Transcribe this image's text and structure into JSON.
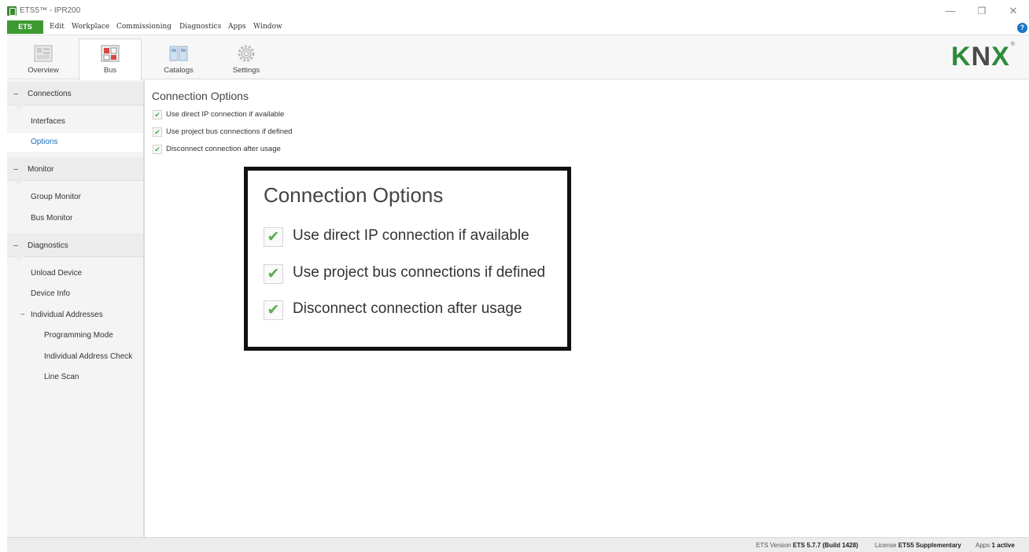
{
  "window": {
    "title": "ETS5™ - IPR200",
    "minimize_glyph": "—",
    "maximize_glyph": "❐",
    "close_glyph": "✕"
  },
  "menubar": {
    "ets_label": "ETS",
    "items": [
      "Edit",
      "Workplace",
      "Commissioning",
      "Diagnostics",
      "Apps",
      "Window"
    ],
    "help_glyph": "?"
  },
  "ribbon": {
    "tabs": [
      {
        "label": "Overview",
        "icon": "overview-icon"
      },
      {
        "label": "Bus",
        "icon": "bus-icon",
        "active": true
      },
      {
        "label": "Catalogs",
        "icon": "catalogs-icon"
      },
      {
        "label": "Settings",
        "icon": "settings-gear-icon"
      }
    ],
    "brand": {
      "k": "K",
      "n": "N",
      "x": "X",
      "reg": "®"
    }
  },
  "sidebar": {
    "sections": [
      {
        "label": "Connections",
        "items": [
          "Interfaces",
          "Options"
        ]
      },
      {
        "label": "Monitor",
        "items": [
          "Group Monitor",
          "Bus Monitor"
        ]
      },
      {
        "label": "Diagnostics",
        "items": [
          "Unload Device",
          "Device Info",
          "Individual Addresses"
        ]
      }
    ],
    "subitems": [
      "Programming Mode",
      "Individual Address Check",
      "Line Scan"
    ],
    "minus_glyph": "−",
    "selected": "Options"
  },
  "main": {
    "title": "Connection Options",
    "options": [
      {
        "label": "Use direct IP connection if available",
        "checked": true
      },
      {
        "label": "Use project bus connections if defined",
        "checked": true
      },
      {
        "label": "Disconnect connection after usage",
        "checked": true
      }
    ],
    "check_glyph": "✔"
  },
  "callout": {
    "title": "Connection Options",
    "options": [
      "Use direct IP connection if available",
      "Use project bus connections if defined",
      "Disconnect connection after usage"
    ]
  },
  "statusbar": {
    "version_label": "ETS Version",
    "version_value": "ETS 5.7.7 (Build 1428)",
    "license_label": "License",
    "license_value": "ETS5 Supplementary",
    "apps_label": "Apps",
    "apps_value": "1 active"
  },
  "colors": {
    "accent_green": "#3d9a31",
    "selected_blue": "#1a6fb8",
    "help_blue": "#1a74c7"
  }
}
